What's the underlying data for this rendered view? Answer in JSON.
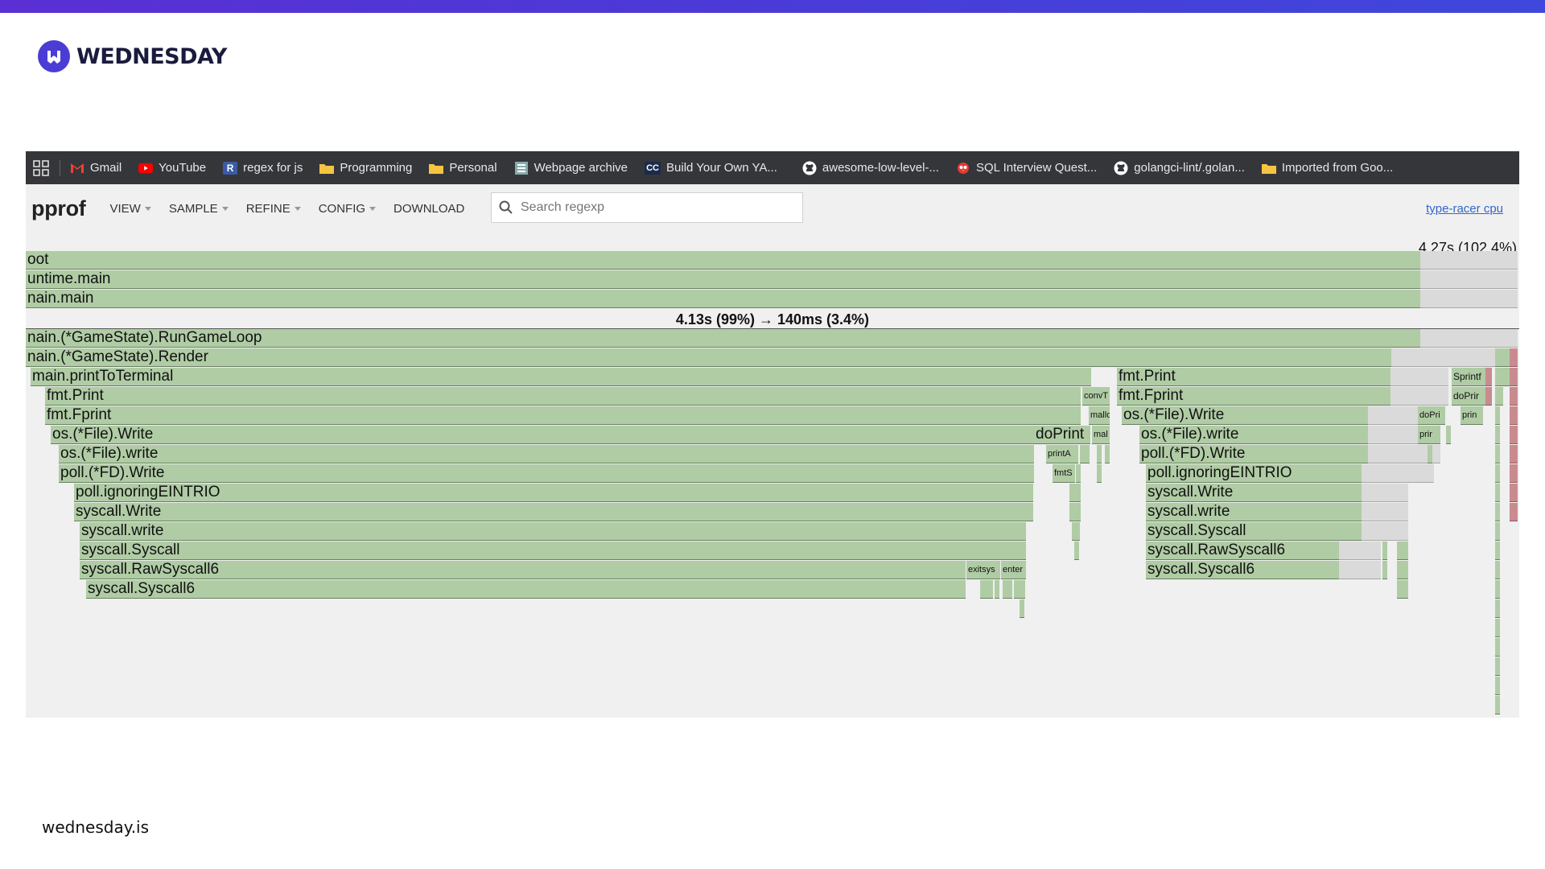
{
  "brand": {
    "name": "WEDNESDAY",
    "url": "wednesday.is",
    "accent": "#4b3cd6"
  },
  "bookmarks": [
    {
      "label": "Gmail",
      "icon": "gmail-icon"
    },
    {
      "label": "YouTube",
      "icon": "youtube-icon"
    },
    {
      "label": "regex for js",
      "icon": "r-icon"
    },
    {
      "label": "Programming",
      "icon": "folder-icon"
    },
    {
      "label": "Personal",
      "icon": "folder-icon"
    },
    {
      "label": "Webpage archive",
      "icon": "archive-icon"
    },
    {
      "label": "Build Your Own YA...",
      "icon": "cc-icon"
    },
    {
      "label": "awesome-low-level-...",
      "icon": "github-icon"
    },
    {
      "label": "SQL Interview Quest...",
      "icon": "bird-icon"
    },
    {
      "label": "golangci-lint/.golan...",
      "icon": "github-icon"
    },
    {
      "label": "Imported from Goo...",
      "icon": "folder-icon"
    }
  ],
  "toolbar": {
    "title": "pprof",
    "menus": [
      "VIEW",
      "SAMPLE",
      "REFINE",
      "CONFIG",
      "DOWNLOAD"
    ],
    "search_placeholder": "Search regexp",
    "profile_link": "type-racer cpu"
  },
  "flame": {
    "total": "4.27s (102.4%)",
    "focus_banner": "4.13s (99%) → 140ms (3.4%)",
    "frames": {
      "root": "oot",
      "runtime_main": "untime.main",
      "main_main": "nain.main",
      "run_game_loop": "nain.(*GameState).RunGameLoop",
      "render": "nain.(*GameState).Render",
      "print_to_terminal": "main.printToTerminal",
      "fmt_print_a": "fmt.Print",
      "fmt_fprint_a": "fmt.Fprint",
      "os_file_write_a": "os.(*File).Write",
      "os_file_write_lower_a": "os.(*File).write",
      "poll_fd_write_a": "poll.(*FD).Write",
      "poll_eintr_a": "poll.ignoringEINTRIO",
      "syscall_write_a": "syscall.Write",
      "syscall_write_lower_a": "syscall.write",
      "syscall_syscall_a": "syscall.Syscall",
      "syscall_raw6_a": "syscall.RawSyscall6",
      "syscall_syscall6_a": "syscall.Syscall6",
      "do_print": "doPrint",
      "print_a": "printA",
      "fmt_s": "fmtS",
      "exitsys": "exitsys",
      "enter": "enter",
      "conv_t": "convT",
      "malloc": "mallo",
      "mal": "mal",
      "fmt_print_b": "fmt.Print",
      "fmt_fprint_b": "fmt.Fprint",
      "os_file_write_b": "os.(*File).Write",
      "os_file_write_lower_b": "os.(*File).write",
      "poll_fd_write_b": "poll.(*FD).Write",
      "poll_eintr_b": "poll.ignoringEINTRIO",
      "syscall_write_b": "syscall.Write",
      "syscall_write_lower_b": "syscall.write",
      "syscall_syscall_b": "syscall.Syscall",
      "syscall_raw6_b": "syscall.RawSyscall6",
      "syscall_syscall6_b": "syscall.Syscall6",
      "sprintf": "Sprintf",
      "do_prir": "doPrir",
      "do_pri": "doPri",
      "prin": "prin",
      "prir": "prir"
    }
  }
}
